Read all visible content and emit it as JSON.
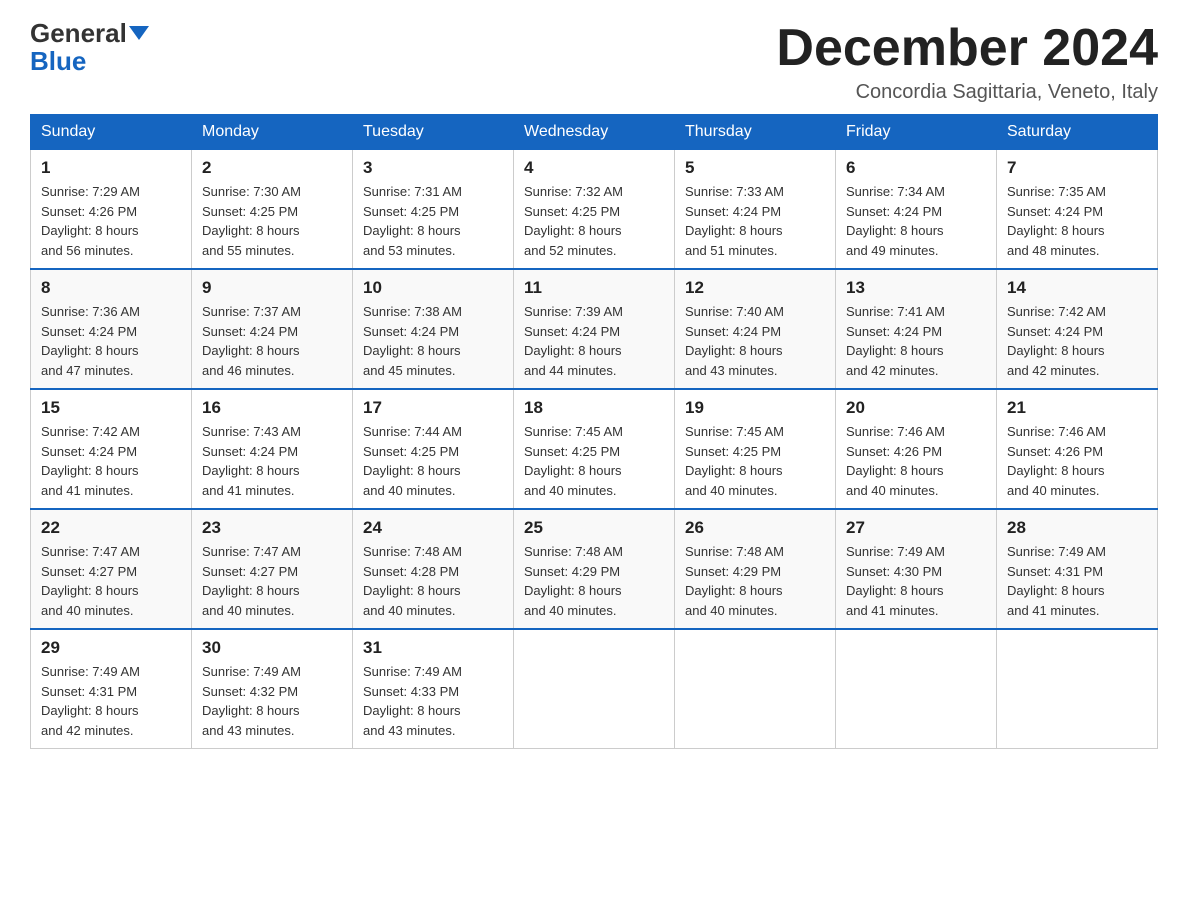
{
  "header": {
    "logo_general": "General",
    "logo_blue": "Blue",
    "month_title": "December 2024",
    "location": "Concordia Sagittaria, Veneto, Italy"
  },
  "weekdays": [
    "Sunday",
    "Monday",
    "Tuesday",
    "Wednesday",
    "Thursday",
    "Friday",
    "Saturday"
  ],
  "weeks": [
    [
      {
        "day": "1",
        "sunrise": "7:29 AM",
        "sunset": "4:26 PM",
        "daylight": "8 hours and 56 minutes."
      },
      {
        "day": "2",
        "sunrise": "7:30 AM",
        "sunset": "4:25 PM",
        "daylight": "8 hours and 55 minutes."
      },
      {
        "day": "3",
        "sunrise": "7:31 AM",
        "sunset": "4:25 PM",
        "daylight": "8 hours and 53 minutes."
      },
      {
        "day": "4",
        "sunrise": "7:32 AM",
        "sunset": "4:25 PM",
        "daylight": "8 hours and 52 minutes."
      },
      {
        "day": "5",
        "sunrise": "7:33 AM",
        "sunset": "4:24 PM",
        "daylight": "8 hours and 51 minutes."
      },
      {
        "day": "6",
        "sunrise": "7:34 AM",
        "sunset": "4:24 PM",
        "daylight": "8 hours and 49 minutes."
      },
      {
        "day": "7",
        "sunrise": "7:35 AM",
        "sunset": "4:24 PM",
        "daylight": "8 hours and 48 minutes."
      }
    ],
    [
      {
        "day": "8",
        "sunrise": "7:36 AM",
        "sunset": "4:24 PM",
        "daylight": "8 hours and 47 minutes."
      },
      {
        "day": "9",
        "sunrise": "7:37 AM",
        "sunset": "4:24 PM",
        "daylight": "8 hours and 46 minutes."
      },
      {
        "day": "10",
        "sunrise": "7:38 AM",
        "sunset": "4:24 PM",
        "daylight": "8 hours and 45 minutes."
      },
      {
        "day": "11",
        "sunrise": "7:39 AM",
        "sunset": "4:24 PM",
        "daylight": "8 hours and 44 minutes."
      },
      {
        "day": "12",
        "sunrise": "7:40 AM",
        "sunset": "4:24 PM",
        "daylight": "8 hours and 43 minutes."
      },
      {
        "day": "13",
        "sunrise": "7:41 AM",
        "sunset": "4:24 PM",
        "daylight": "8 hours and 42 minutes."
      },
      {
        "day": "14",
        "sunrise": "7:42 AM",
        "sunset": "4:24 PM",
        "daylight": "8 hours and 42 minutes."
      }
    ],
    [
      {
        "day": "15",
        "sunrise": "7:42 AM",
        "sunset": "4:24 PM",
        "daylight": "8 hours and 41 minutes."
      },
      {
        "day": "16",
        "sunrise": "7:43 AM",
        "sunset": "4:24 PM",
        "daylight": "8 hours and 41 minutes."
      },
      {
        "day": "17",
        "sunrise": "7:44 AM",
        "sunset": "4:25 PM",
        "daylight": "8 hours and 40 minutes."
      },
      {
        "day": "18",
        "sunrise": "7:45 AM",
        "sunset": "4:25 PM",
        "daylight": "8 hours and 40 minutes."
      },
      {
        "day": "19",
        "sunrise": "7:45 AM",
        "sunset": "4:25 PM",
        "daylight": "8 hours and 40 minutes."
      },
      {
        "day": "20",
        "sunrise": "7:46 AM",
        "sunset": "4:26 PM",
        "daylight": "8 hours and 40 minutes."
      },
      {
        "day": "21",
        "sunrise": "7:46 AM",
        "sunset": "4:26 PM",
        "daylight": "8 hours and 40 minutes."
      }
    ],
    [
      {
        "day": "22",
        "sunrise": "7:47 AM",
        "sunset": "4:27 PM",
        "daylight": "8 hours and 40 minutes."
      },
      {
        "day": "23",
        "sunrise": "7:47 AM",
        "sunset": "4:27 PM",
        "daylight": "8 hours and 40 minutes."
      },
      {
        "day": "24",
        "sunrise": "7:48 AM",
        "sunset": "4:28 PM",
        "daylight": "8 hours and 40 minutes."
      },
      {
        "day": "25",
        "sunrise": "7:48 AM",
        "sunset": "4:29 PM",
        "daylight": "8 hours and 40 minutes."
      },
      {
        "day": "26",
        "sunrise": "7:48 AM",
        "sunset": "4:29 PM",
        "daylight": "8 hours and 40 minutes."
      },
      {
        "day": "27",
        "sunrise": "7:49 AM",
        "sunset": "4:30 PM",
        "daylight": "8 hours and 41 minutes."
      },
      {
        "day": "28",
        "sunrise": "7:49 AM",
        "sunset": "4:31 PM",
        "daylight": "8 hours and 41 minutes."
      }
    ],
    [
      {
        "day": "29",
        "sunrise": "7:49 AM",
        "sunset": "4:31 PM",
        "daylight": "8 hours and 42 minutes."
      },
      {
        "day": "30",
        "sunrise": "7:49 AM",
        "sunset": "4:32 PM",
        "daylight": "8 hours and 43 minutes."
      },
      {
        "day": "31",
        "sunrise": "7:49 AM",
        "sunset": "4:33 PM",
        "daylight": "8 hours and 43 minutes."
      },
      null,
      null,
      null,
      null
    ]
  ],
  "labels": {
    "sunrise": "Sunrise:",
    "sunset": "Sunset:",
    "daylight": "Daylight:"
  }
}
